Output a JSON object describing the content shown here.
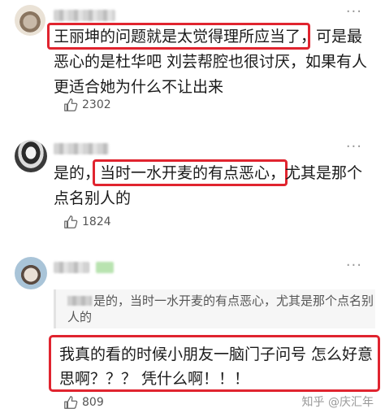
{
  "comments": [
    {
      "text": "王丽坤的问题就是太觉得理所应当了，可是最恶心的是杜华吧 刘芸帮腔也很讨厌，如果有人更适合她为什么不让出来",
      "highlight": "王丽坤的问题就是太觉得理所应当了",
      "likes": "2302",
      "menu": "···"
    },
    {
      "text": "是的，当时一水开麦的有点恶心，尤其是那个点名别人的",
      "highlight": "当时一水开麦的有点恶心，",
      "likes": "1824",
      "menu": "···"
    },
    {
      "quote": "是的，当时一水开麦的有点恶心，尤其是那个点名别人的",
      "text": "我真的看的时候小朋友一脑门子问号 怎么好意思啊？？？ 凭什么啊！！！",
      "likes": "809",
      "menu": "···"
    }
  ],
  "watermark": "知乎 @庆汇年",
  "icons": {
    "like": "thumbs-up-icon",
    "menu": "more-dots-icon"
  },
  "colors": {
    "highlight_border": "#e0242f",
    "text": "#1a1a1a",
    "muted": "#555555"
  }
}
